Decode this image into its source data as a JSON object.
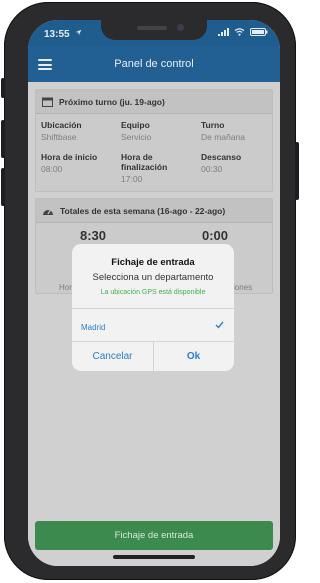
{
  "status_bar": {
    "time": "13:55",
    "location_icon": "location-arrow-icon",
    "signal_icon": "signal-icon",
    "wifi_icon": "wifi-icon",
    "battery_icon": "battery-icon"
  },
  "header": {
    "title": "Panel de control",
    "menu_icon": "hamburger-menu-icon"
  },
  "next_shift": {
    "title": "Próximo turno (ju. 19-ago)",
    "icon": "calendar-icon",
    "fields": [
      {
        "label": "Ubicación",
        "value": "Shiftbase"
      },
      {
        "label": "Equipo",
        "value": "Servicio"
      },
      {
        "label": "Turno",
        "value": "De mañana"
      },
      {
        "label": "Hora de inicio",
        "value": "08:00"
      },
      {
        "label": "Hora de finalización",
        "value": "17:00"
      },
      {
        "label": "Descanso",
        "value": "00:30"
      }
    ]
  },
  "week_totals": {
    "title": "Totales de esta semana (16-ago - 22-ago)",
    "icon": "speedometer-icon",
    "hours_value": "8:30",
    "hours_label": "Hor",
    "corrections_value": "0:00",
    "corrections_label": "ciones"
  },
  "dialog": {
    "title": "Fichaje de entrada",
    "subtitle": "Selecciona un departamento",
    "gps_note": "La ubicación GPS está disponible",
    "option": "Madrid",
    "check_icon": "checkmark-icon",
    "cancel_label": "Cancelar",
    "ok_label": "Ok"
  },
  "check_in_button": "Fichaje de entrada",
  "colors": {
    "header": "#225f92",
    "accent": "#2b7fc7",
    "success": "#3d8a4e",
    "gps": "#43b04e"
  }
}
